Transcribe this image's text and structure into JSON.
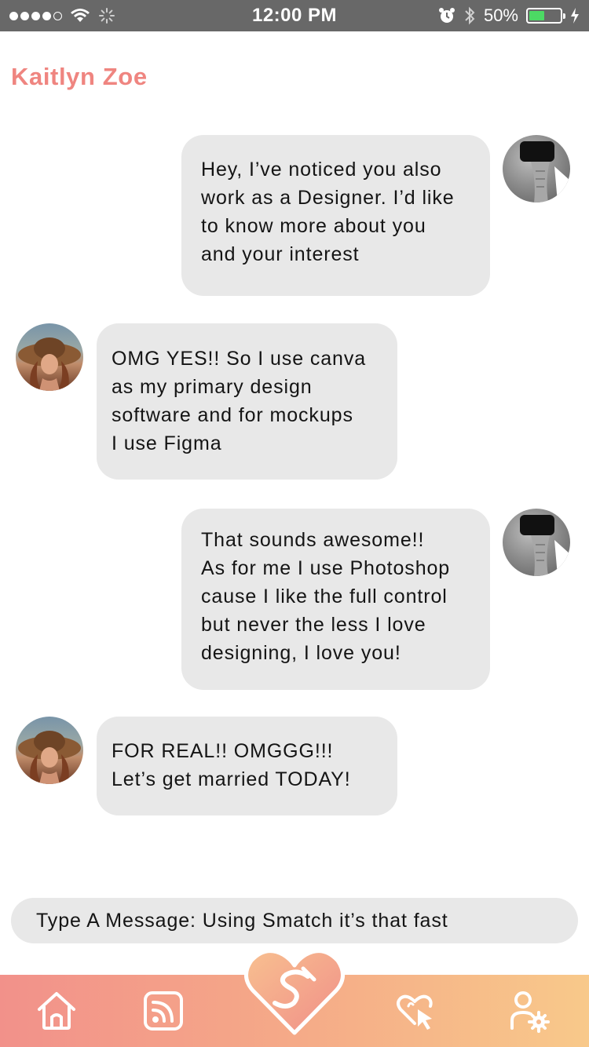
{
  "status_bar": {
    "time": "12:00 PM",
    "battery_percent": "50%",
    "battery_level": 0.5,
    "signal_dots": 5,
    "signal_filled": 4
  },
  "chat": {
    "contact_name": "Kaitlyn Zoe",
    "messages": [
      {
        "sender": "me",
        "text": "Hey, I’ve noticed you also\nwork as a Designer. I’d like\nto know more about you\nand your interest"
      },
      {
        "sender": "them",
        "text": "OMG YES!! So I use canva\nas my primary design\nsoftware and for mockups\nI use Figma"
      },
      {
        "sender": "me",
        "text": "That sounds awesome!!\nAs for me I use Photoshop\ncause I like the full control\nbut never the less I love\ndesigning, I love you!"
      },
      {
        "sender": "them",
        "text": "FOR REAL!! OMGGG!!!\nLet’s get married TODAY!"
      }
    ]
  },
  "composer": {
    "text": "Type A Message: Using Smatch it’s that fast"
  },
  "nav": {
    "items": [
      {
        "icon": "home-icon"
      },
      {
        "icon": "feed-icon"
      },
      {
        "icon": "smatch-heart-icon"
      },
      {
        "icon": "heart-cursor-icon"
      },
      {
        "icon": "user-settings-icon"
      }
    ]
  },
  "colors": {
    "accent": "#ef8580",
    "bubble": "#e8e8e8",
    "status_bar": "#686868",
    "nav_gradient_start": "#f2918a",
    "nav_gradient_end": "#f8c98a"
  }
}
